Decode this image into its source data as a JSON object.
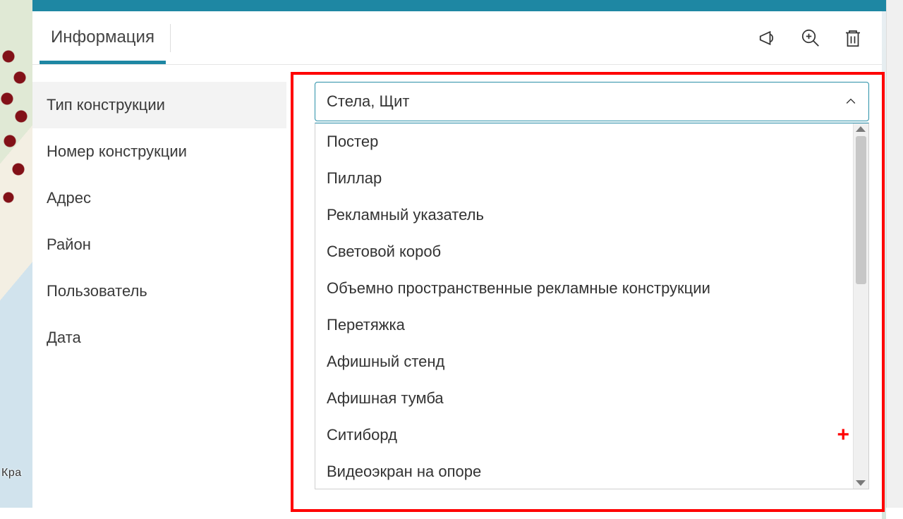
{
  "tabs": {
    "info": "Информация"
  },
  "toolbar_icons": {
    "announce": "megaphone-icon",
    "zoom": "zoom-in-icon",
    "delete": "trash-icon"
  },
  "labels": {
    "type": "Тип конструкции",
    "number": "Номер конструкции",
    "address": "Адрес",
    "district": "Район",
    "user": "Пользователь",
    "date": "Дата"
  },
  "type_select": {
    "value": "Стела, Щит",
    "options": [
      "Постер",
      "Пиллар",
      "Рекламный указатель",
      "Световой короб",
      "Объемно пространственные рекламные конструкции",
      "Перетяжка",
      "Афишный стенд",
      "Афишная тумба",
      "Ситиборд",
      "Видеоэкран на опоре"
    ]
  },
  "map_fragment": "Кра",
  "plus": "+"
}
